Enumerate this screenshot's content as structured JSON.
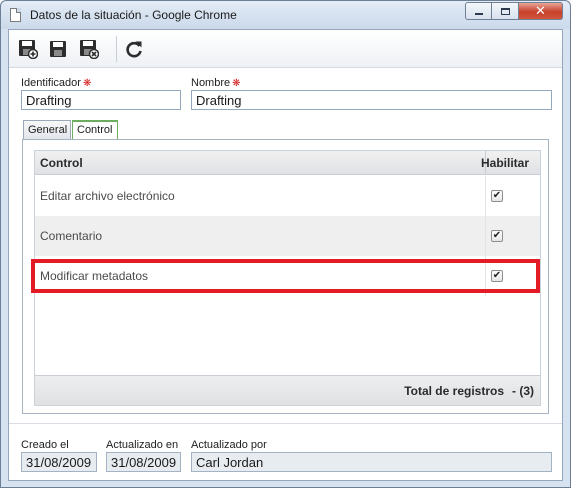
{
  "window": {
    "title": "Datos de la situación - Google Chrome",
    "controls": {
      "minimize": "minimize-icon",
      "maximize": "maximize-icon",
      "close": "close-icon"
    }
  },
  "toolbar": {
    "buttons": [
      {
        "name": "save-new",
        "icon": "save-new-icon"
      },
      {
        "name": "save",
        "icon": "save-icon"
      },
      {
        "name": "save-close",
        "icon": "save-close-icon"
      },
      {
        "name": "refresh",
        "icon": "refresh-icon"
      }
    ]
  },
  "form": {
    "identificador_label": "Identificador",
    "identificador_value": "Drafting",
    "nombre_label": "Nombre",
    "nombre_value": "Drafting",
    "required_mark": "❋"
  },
  "tabs": [
    {
      "label": "General",
      "active": false
    },
    {
      "label": "Control",
      "active": true
    }
  ],
  "grid": {
    "columns": [
      "Control",
      "Habilitar"
    ],
    "rows": [
      {
        "control": "Editar archivo electrónico",
        "enabled": true
      },
      {
        "control": "Comentario",
        "enabled": true
      },
      {
        "control": "Modificar metadatos",
        "enabled": true
      }
    ],
    "footer_label": "Total de registros",
    "footer_count": "- (3)",
    "highlighted_row": "Modificar metadatos"
  },
  "footer": {
    "creado_label": "Creado el",
    "creado_value": "31/08/2009",
    "actualizado_en_label": "Actualizado en",
    "actualizado_en_value": "31/08/2009",
    "actualizado_por_label": "Actualizado por",
    "actualizado_por_value": "Carl Jordan"
  },
  "colors": {
    "highlight": "#e21b25",
    "required": "#d21d1d",
    "active_tab": "#6cae5d"
  }
}
